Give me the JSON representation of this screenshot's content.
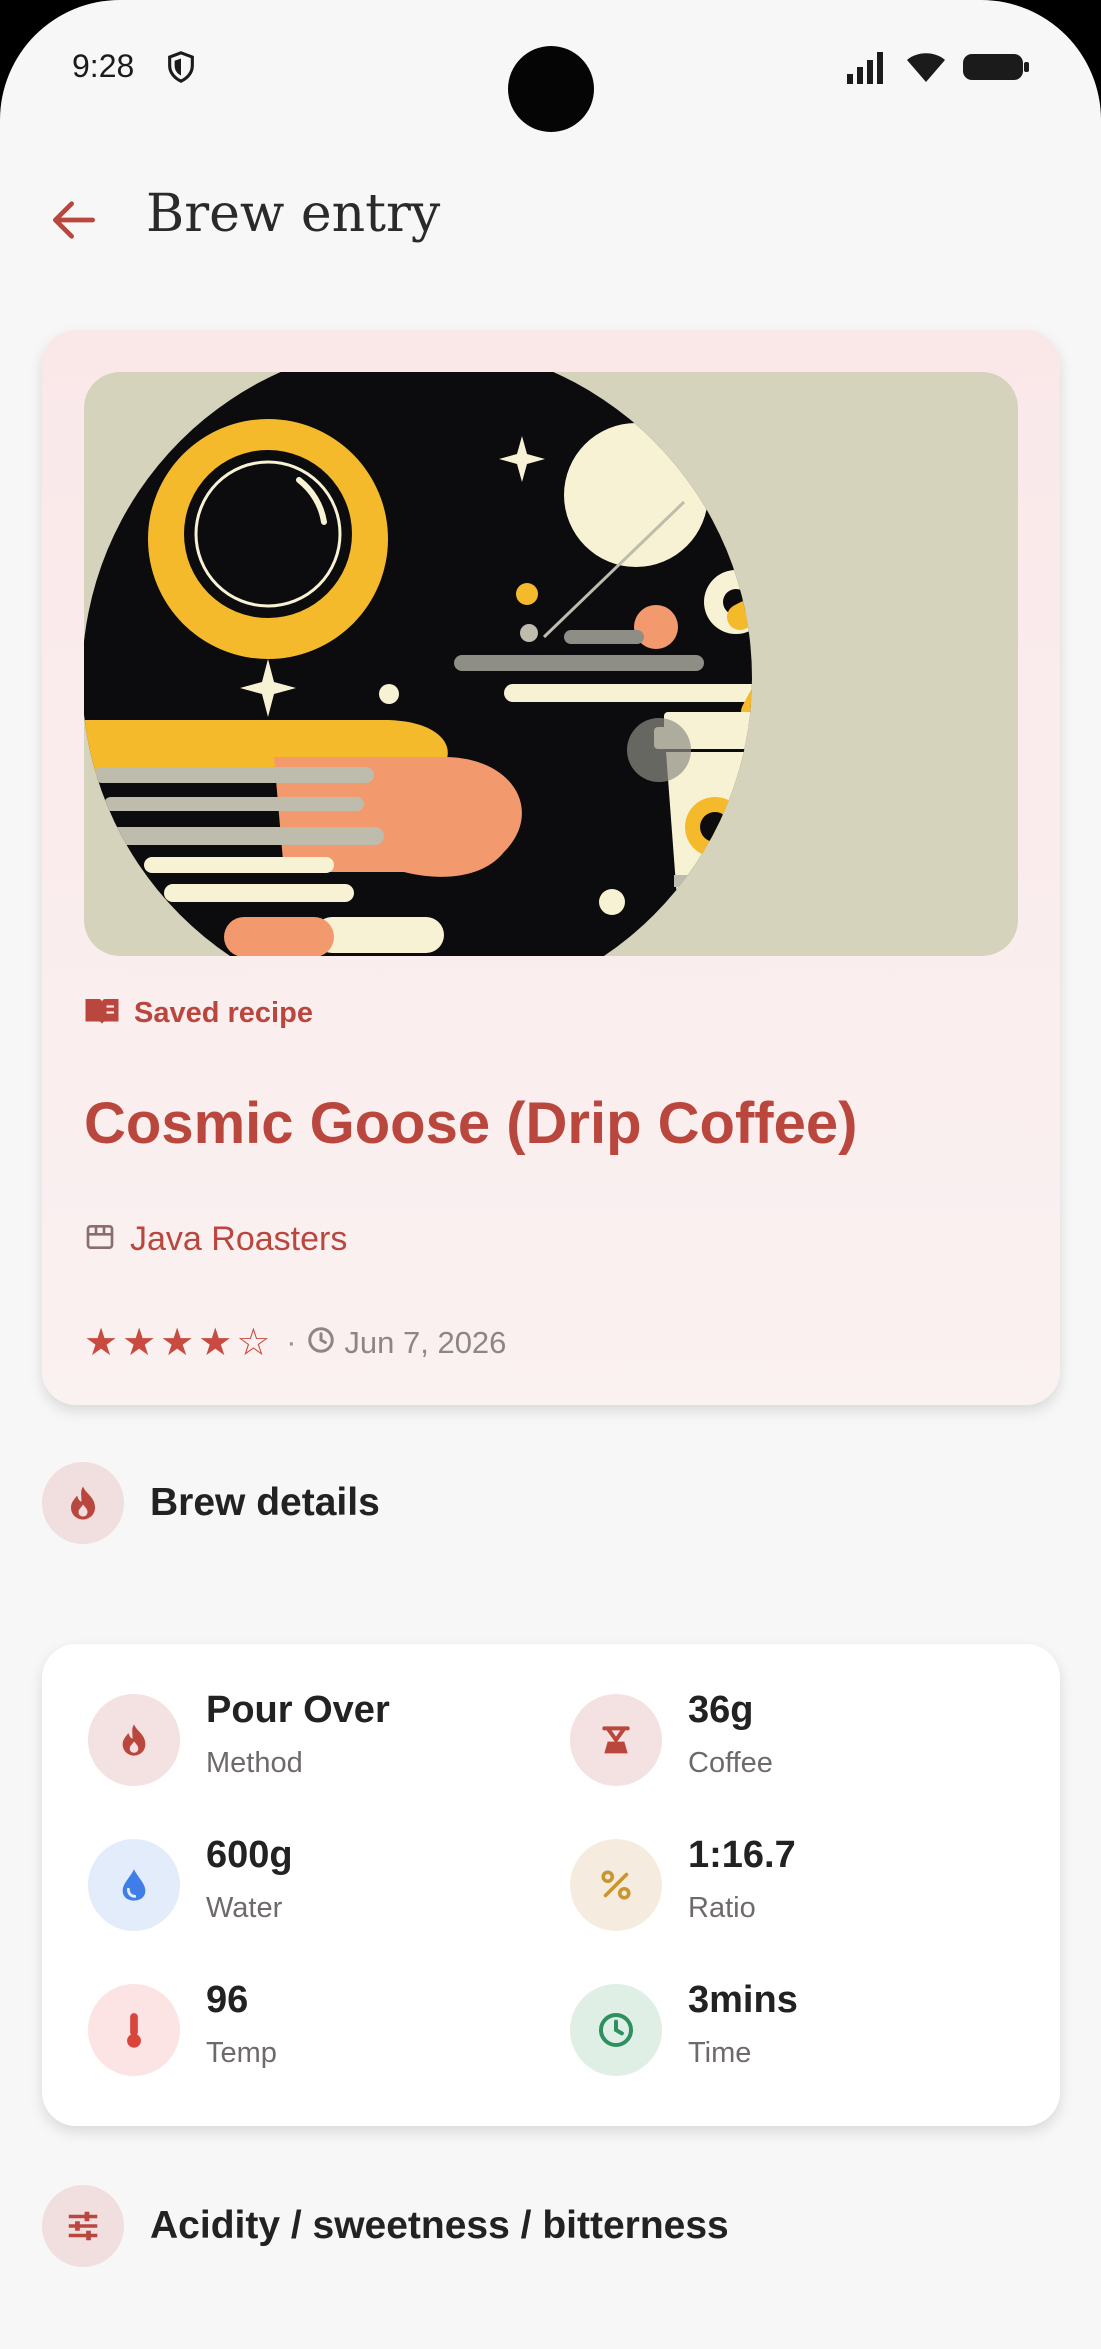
{
  "status_bar": {
    "time": "9:28"
  },
  "app_bar": {
    "title": "Brew entry"
  },
  "recipe": {
    "badge": "Saved recipe",
    "title": "Cosmic Goose (Drip Coffee)",
    "roaster": "Java Roasters",
    "rating": 4,
    "rating_max": 5,
    "date": "Jun 7, 2026"
  },
  "sections": {
    "brew_details": "Brew details",
    "taste": "Acidity / sweetness / bitterness"
  },
  "stats": {
    "method": {
      "value": "Pour Over",
      "label": "Method"
    },
    "coffee": {
      "value": "36g",
      "label": "Coffee"
    },
    "water": {
      "value": "600g",
      "label": "Water"
    },
    "ratio": {
      "value": "1:16.7",
      "label": "Ratio"
    },
    "temp": {
      "value": "96",
      "label": "Temp"
    },
    "time": {
      "value": "3mins",
      "label": "Time"
    }
  },
  "colors": {
    "accent": "#b9473e",
    "water_icon": "#3f7ee8",
    "ratio_icon": "#c9952e",
    "time_icon": "#2e8f5f",
    "temp_icon": "#d9453b"
  }
}
